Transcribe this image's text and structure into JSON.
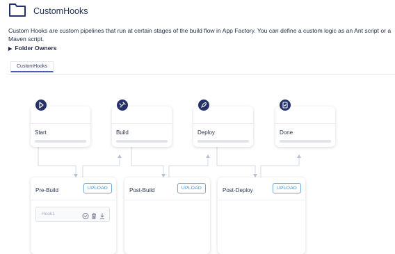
{
  "header": {
    "title": "CustomHooks",
    "icon": "folder-icon"
  },
  "description": "Custom Hooks are custom pipelines that run at certain stages of the build flow in App Factory. You can define a custom logic as an Ant script or a Maven script.",
  "folder_owners": {
    "label": "Folder Owners",
    "icon": "triangle-right-icon"
  },
  "tabs": [
    {
      "label": "CustomHooks",
      "active": true
    }
  ],
  "stages": [
    {
      "label": "Start",
      "icon": "start-icon"
    },
    {
      "label": "Build",
      "icon": "build-icon"
    },
    {
      "label": "Deploy",
      "icon": "rocket-icon"
    },
    {
      "label": "Done",
      "icon": "clipboard-check-icon"
    }
  ],
  "phases": [
    {
      "title": "Pre-Build",
      "upload_label": "UPLOAD",
      "hooks": [
        {
          "name": "Hook1"
        }
      ]
    },
    {
      "title": "Post-Build",
      "upload_label": "UPLOAD",
      "hooks": []
    },
    {
      "title": "Post-Deploy",
      "upload_label": "UPLOAD",
      "hooks": []
    }
  ],
  "colors": {
    "icon_circle": "#25326a",
    "accent": "#3d63b8",
    "upload_border": "#6fa8dc",
    "upload_text": "#3d8fd1"
  }
}
